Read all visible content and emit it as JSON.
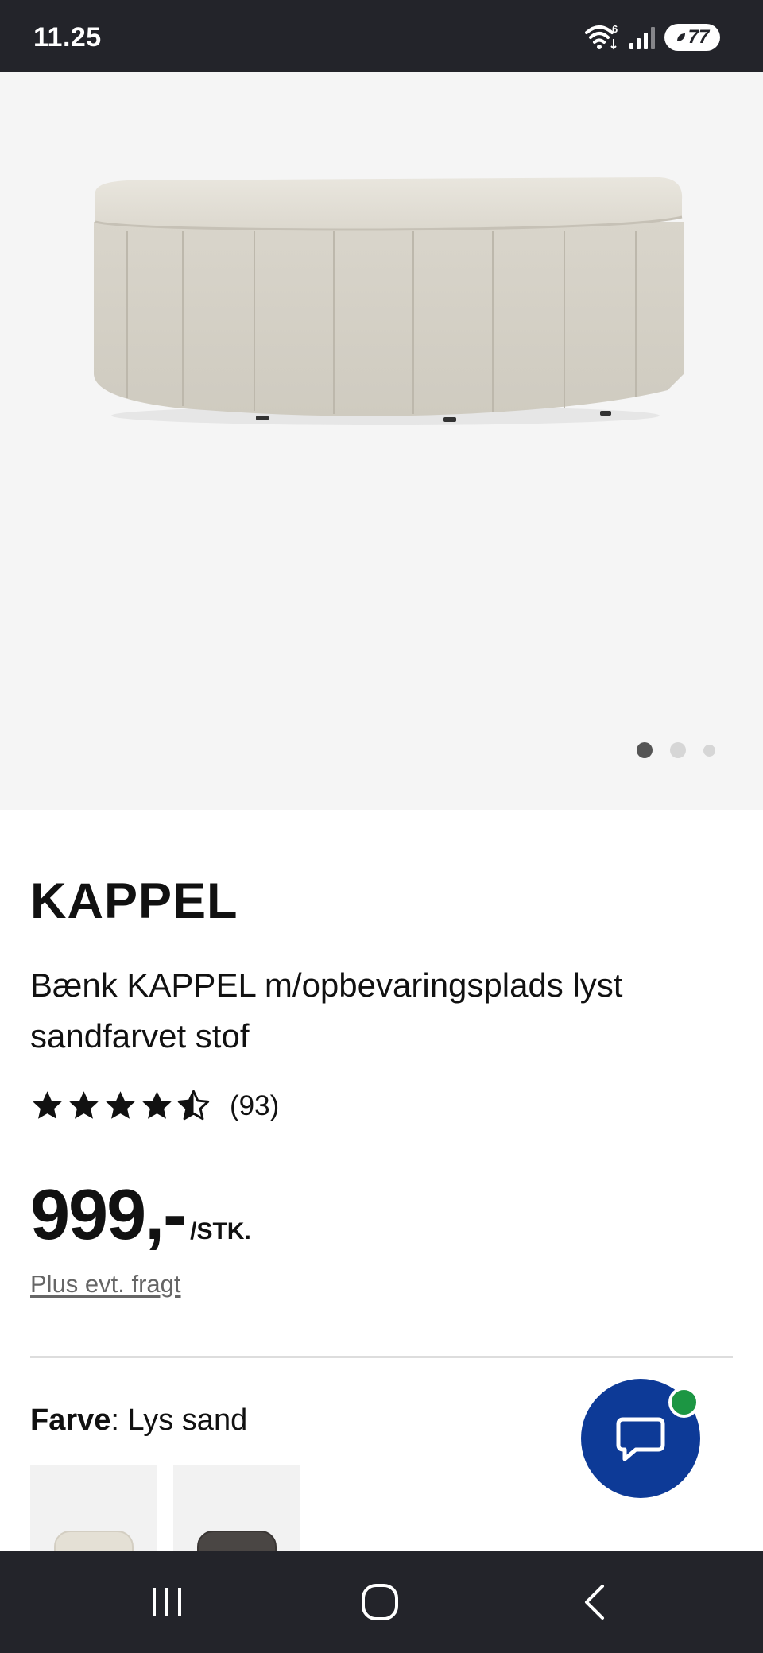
{
  "status_bar": {
    "time": "11.25",
    "wifi_badge": "6",
    "battery": "77"
  },
  "gallery": {
    "image_icon": "kappel-bench-image",
    "slide_count": 3,
    "active_slide": 1
  },
  "product": {
    "brand": "KAPPEL",
    "description": "Bænk KAPPEL m/opbevaringsplads lyst sandfarvet stof",
    "rating": 4.5,
    "rating_max": 5,
    "review_count": "(93)",
    "price": "999,-",
    "price_unit": "/STK.",
    "shipping_link": "Plus evt. fragt"
  },
  "color": {
    "label": "Farve",
    "separator": ":",
    "value": " Lys sand",
    "swatches": [
      {
        "name": "Lys sand",
        "color": "#e8e3d6"
      },
      {
        "name": "Dark",
        "color": "#4a4644"
      }
    ]
  },
  "chat": {
    "icon": "chat-bubble-icon",
    "accent": "#0d3a97",
    "notification_color": "#1c9643"
  },
  "nav": {
    "recents_icon": "recents-icon",
    "home_icon": "home-icon",
    "back_icon": "back-icon"
  }
}
